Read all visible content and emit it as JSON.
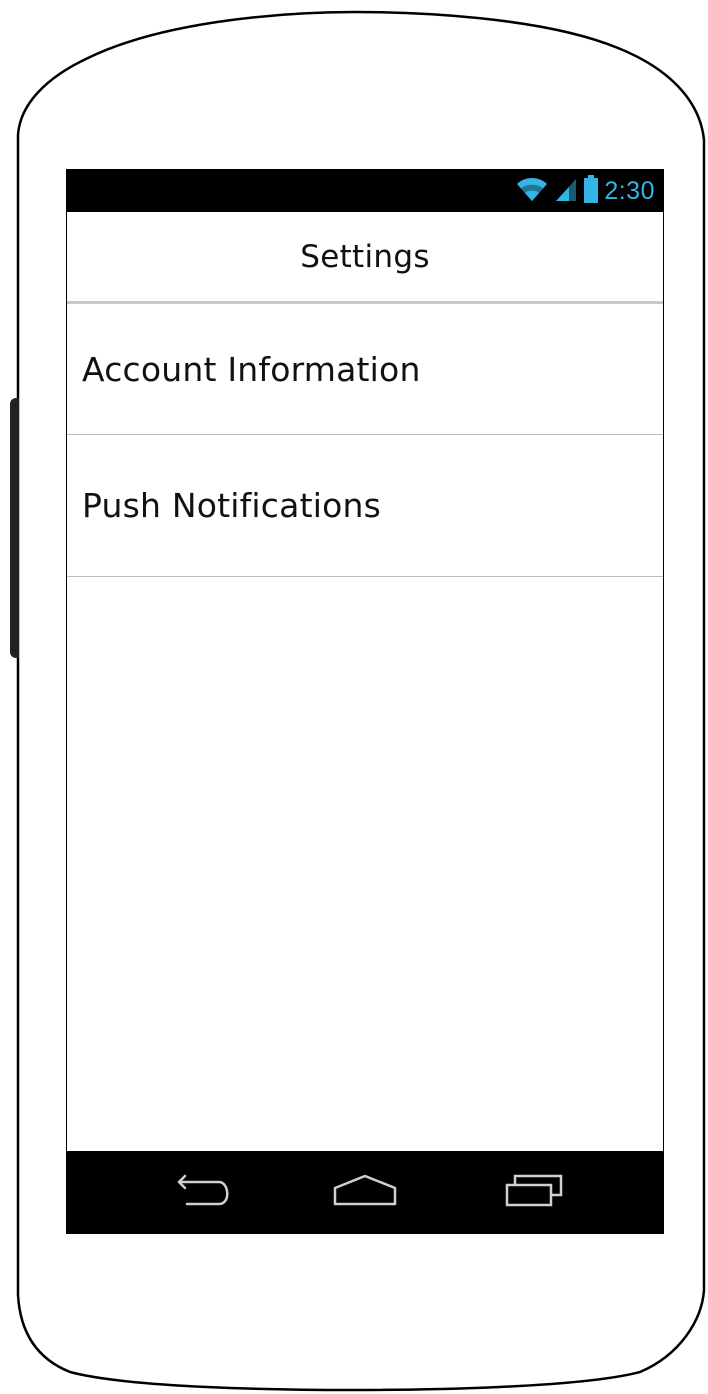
{
  "status_bar": {
    "time": "2:30",
    "icons": [
      "wifi-icon",
      "signal-icon",
      "battery-icon"
    ],
    "accent_color": "#33b5e5"
  },
  "action_bar": {
    "title": "Settings"
  },
  "settings_list": {
    "items": [
      {
        "label": "Account Information"
      },
      {
        "label": "Push Notifications"
      }
    ]
  },
  "nav_bar": {
    "buttons": [
      "back-icon",
      "home-icon",
      "recent-apps-icon"
    ],
    "icon_color": "#d0d0d0"
  }
}
